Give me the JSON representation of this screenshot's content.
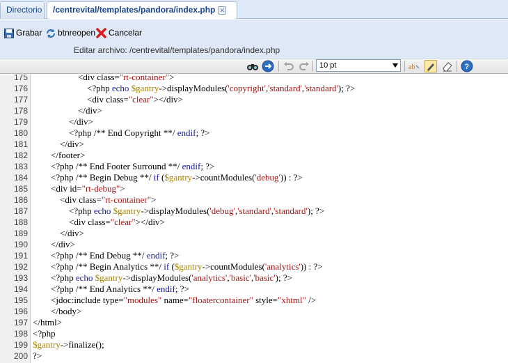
{
  "tabs": [
    {
      "label": "Directorio"
    },
    {
      "label": "/centrevital/templates/pandora/index.php"
    }
  ],
  "toolbar": {
    "save_label": "Grabar",
    "reopen_label": "btnreopen",
    "cancel_label": "Cancelar"
  },
  "edit_label": "Editar archivo: /centrevital/templates/pandora/index.php",
  "editor_toolbar": {
    "font_size": "10 pt"
  },
  "code_lines": [
    {
      "n": "175",
      "text": "                    <div class=\"rt-container\">"
    },
    {
      "n": "176",
      "text": "                        <?php echo $gantry->displayModules('copyright','standard','standard'); ?>"
    },
    {
      "n": "177",
      "text": "                        <div class=\"clear\"></div>"
    },
    {
      "n": "178",
      "text": "                    </div>"
    },
    {
      "n": "179",
      "text": "                </div>"
    },
    {
      "n": "180",
      "text": "                <?php /** End Copyright **/ endif; ?>"
    },
    {
      "n": "181",
      "text": "            </div>"
    },
    {
      "n": "182",
      "text": "        </footer>"
    },
    {
      "n": "183",
      "text": "        <?php /** End Footer Surround **/ endif; ?>"
    },
    {
      "n": "184",
      "text": "        <?php /** Begin Debug **/ if ($gantry->countModules('debug')) : ?>"
    },
    {
      "n": "185",
      "text": "        <div id=\"rt-debug\">"
    },
    {
      "n": "186",
      "text": "            <div class=\"rt-container\">"
    },
    {
      "n": "187",
      "text": "                <?php echo $gantry->displayModules('debug','standard','standard'); ?>"
    },
    {
      "n": "188",
      "text": "                <div class=\"clear\"></div>"
    },
    {
      "n": "189",
      "text": "            </div>"
    },
    {
      "n": "190",
      "text": "        </div>"
    },
    {
      "n": "191",
      "text": "        <?php /** End Debug **/ endif; ?>"
    },
    {
      "n": "192",
      "text": "        <?php /** Begin Analytics **/ if ($gantry->countModules('analytics')) : ?>"
    },
    {
      "n": "193",
      "text": "        <?php echo $gantry->displayModules('analytics','basic','basic'); ?>"
    },
    {
      "n": "194",
      "text": "        <?php /** End Analytics **/ endif; ?>"
    },
    {
      "n": "195",
      "text": "        <jdoc:include type=\"modules\" name=\"floatercontainer\" style=\"xhtml\" />"
    },
    {
      "n": "196",
      "text": "        </body>"
    },
    {
      "n": "197",
      "text": "</html>"
    },
    {
      "n": "198",
      "text": "<?php"
    },
    {
      "n": "199",
      "text": "$gantry->finalize();"
    },
    {
      "n": "200",
      "text": "?>"
    }
  ]
}
